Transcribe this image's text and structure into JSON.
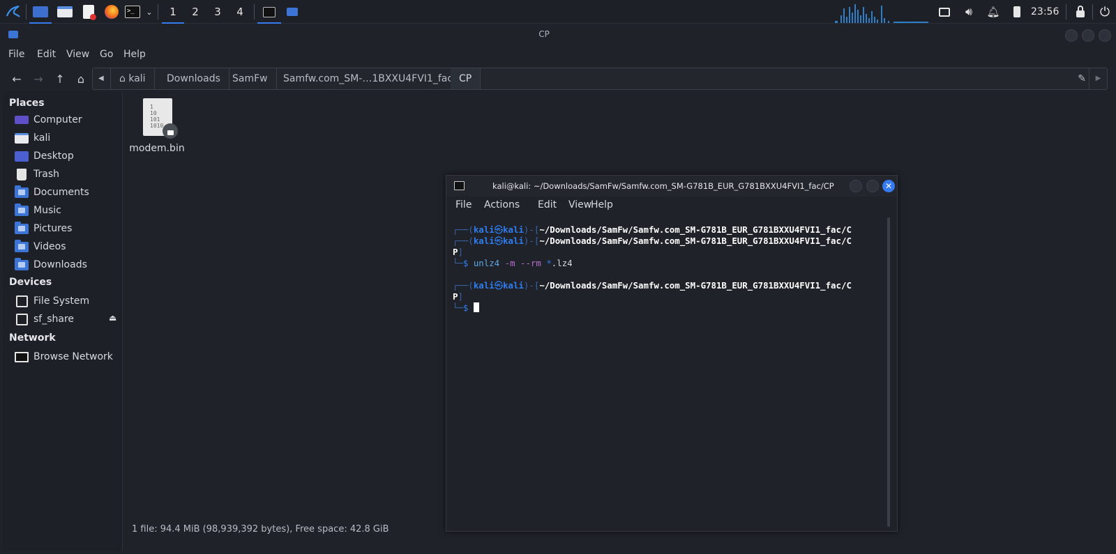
{
  "panel": {
    "workspaces": [
      "1",
      "2",
      "3",
      "4"
    ],
    "clock": "23:56",
    "icons": [
      "kali-menu-icon",
      "show-desktop-icon",
      "file-manager-launcher-icon",
      "text-editor-icon",
      "firefox-icon",
      "terminal-launcher-icon",
      "launcher-dropdown-icon",
      "terminal-task-icon",
      "file-manager-task-icon",
      "network-graph",
      "network-icon",
      "volume-icon",
      "bell-icon",
      "battery-icon",
      "lock-icon",
      "power-icon"
    ]
  },
  "file_manager": {
    "title": "CP",
    "menu": [
      "File",
      "Edit",
      "View",
      "Go",
      "Help"
    ],
    "breadcrumbs": [
      "kali",
      "Downloads",
      "SamFw",
      "Samfw.com_SM-…1BXXU4FVI1_fac",
      "CP"
    ],
    "sidebar": {
      "places_header": "Places",
      "places": [
        "Computer",
        "kali",
        "Desktop",
        "Trash",
        "Documents",
        "Music",
        "Pictures",
        "Videos",
        "Downloads"
      ],
      "devices_header": "Devices",
      "devices": [
        "File System",
        "sf_share"
      ],
      "network_header": "Network",
      "network": [
        "Browse Network"
      ]
    },
    "files": [
      {
        "name": "modem.bin",
        "icon_text": "1\n10\n101\n1010"
      }
    ],
    "status": "1 file: 94.4 MiB (98,939,392 bytes), Free space: 42.8 GiB"
  },
  "terminal": {
    "title": "kali@kali: ~/Downloads/SamFw/Samfw.com_SM-G781B_EUR_G781BXXU4FVI1_fac/CP",
    "menu": [
      "File",
      "Actions",
      "Edit",
      "View",
      "Help"
    ],
    "prompt_user": "kali",
    "prompt_host": "kali",
    "path_part1": "~/Downloads/SamFw/Samfw.com_SM-G781B_EUR_G781BXXU4FVI1_fac/C",
    "path_part2": "P",
    "cmd_name": "unlz4",
    "cmd_opt1": "-m",
    "cmd_opt2": "--rm",
    "cmd_glob": "*",
    "cmd_rest": ".lz4"
  }
}
